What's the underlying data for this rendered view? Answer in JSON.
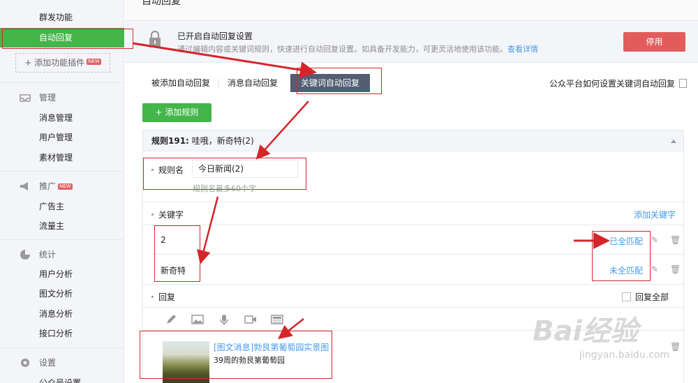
{
  "sidebar": {
    "func_items": [
      {
        "label": "群发功能"
      },
      {
        "label": "自动回复"
      }
    ],
    "add_plugin": "添加功能插件",
    "new_badge": "NEW",
    "groups": {
      "manage": {
        "title": "管理",
        "items": [
          "消息管理",
          "用户管理",
          "素材管理"
        ]
      },
      "promote": {
        "title": "推广",
        "items": [
          "广告主",
          "流量主"
        ]
      },
      "stats": {
        "title": "统计",
        "items": [
          "用户分析",
          "图文分析",
          "消息分析",
          "接口分析"
        ]
      },
      "settings": {
        "title": "设置",
        "items": [
          "公众号设置"
        ]
      }
    }
  },
  "page": {
    "title": "自动回复"
  },
  "status": {
    "title": "已开启自动回复设置",
    "desc": "通过编辑内容或关键词规则，快速进行自动回复设置。如具备开发能力，可更灵活地使用该功能。",
    "link": "查看详情",
    "stop_label": "停用"
  },
  "tabs": [
    "被添加自动回复",
    "消息自动回复",
    "关键词自动回复"
  ],
  "help_link": "公众平台如何设置关键词自动回复",
  "add_rule": "添加规则",
  "rule": {
    "head_label": "规则191:",
    "head_value": "哇哦，新奇特(2)",
    "name_label": "规则名",
    "name_value": "今日新闻(2)",
    "name_hint": "规则名最多60个字",
    "keyword_label": "关键字",
    "add_keyword": "添加关键字",
    "keywords": [
      {
        "text": "2",
        "match": "已全匹配"
      },
      {
        "text": "新奇特",
        "match": "未全匹配"
      }
    ],
    "reply_label": "回复",
    "reply_all": "回复全部",
    "news_title": "[图文消息]勃艮第葡萄园实景图",
    "news_sub": "39周的勃艮第葡萄园"
  },
  "watermark": {
    "brand": "Bai经验",
    "url": "jingyan.baidu.com"
  },
  "colors": {
    "green": "#44b549",
    "red": "#e25c5c",
    "link": "#459ae9",
    "tab_active": "#535d73",
    "annotation": "#d4252b"
  }
}
